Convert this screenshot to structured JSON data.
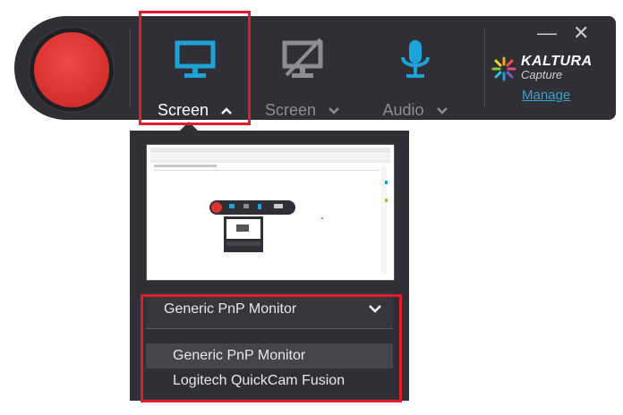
{
  "toolbar": {
    "record_icon": "record-button",
    "tools": [
      {
        "label": "Screen",
        "icon": "monitor-icon",
        "state": "active",
        "chevron": "up"
      },
      {
        "label": "Screen",
        "icon": "monitor-disabled-icon",
        "state": "inactive",
        "chevron": "down"
      },
      {
        "label": "Audio",
        "icon": "microphone-icon",
        "state": "inactive",
        "chevron": "down"
      }
    ],
    "window_controls": {
      "minimize": "—",
      "close": "✕"
    },
    "brand": {
      "name": "KALTURA",
      "sub": "Capture",
      "link": "Manage"
    }
  },
  "screen_panel": {
    "selected_monitor": "Generic PnP Monitor",
    "options": [
      {
        "label": "Generic PnP Monitor",
        "highlighted": true
      },
      {
        "label": "Logitech QuickCam Fusion",
        "highlighted": false
      }
    ]
  },
  "colors": {
    "accent": "#1ea3d8",
    "record": "#dc3431",
    "highlight_box": "#e21c2a",
    "toolbar_bg": "#2f2f35"
  }
}
